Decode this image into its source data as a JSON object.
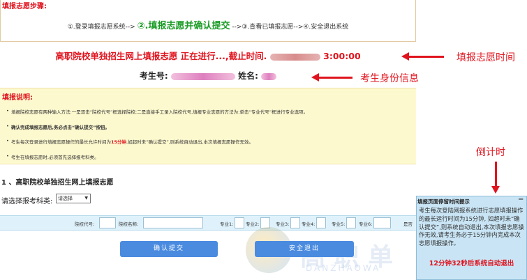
{
  "steps": {
    "heading": "填报志愿步骤:",
    "step1": "①.登录填报志愿系统-->",
    "step2": "②.填报志愿并确认提交",
    "step3": "-->③.查看已填报志愿-->④.安全退出系统"
  },
  "status": {
    "text": "高职院校单独招生网上填报志愿 正在进行...,截止时间.",
    "deadline_visible_tail": "3:00:00",
    "candidate_no_label": "考生号:",
    "name_label": "姓名:"
  },
  "annotations": {
    "deadline": "填报志愿时间",
    "identity": "考生身份信息",
    "countdown": "倒计时"
  },
  "instructions": {
    "heading": "填报说明:",
    "item1": "填报院校志愿有两种输入方法:一是双击“院校代号”框选择院校;二是直接手工录入院校代号,填报专业志愿的方法为:单击“专业代号”框进行专业选项。",
    "item2": "确认完成填报志愿后,务必点击“确认提交”按钮。",
    "item3_pre": "考生每次登录进行填报志愿操作的最长允许时间为",
    "item3_highlight": "15分钟",
    "item3_post": ",如超时未“确认提交”,则系统自动退出,本次填报志愿操作无效。",
    "item4": "考生在填报志愿时,必须首先选择报考科类。"
  },
  "section": {
    "title": "1 、高职院校单独招生网上填报志愿",
    "category_label": "请选择报考科类:",
    "category_select": "请选择"
  },
  "form": {
    "school_code": "院校代号:",
    "school_name": "院校名称:",
    "major1": "专业1:",
    "major2": "专业2:",
    "major3": "专业3:",
    "major4": "专业4:",
    "major5": "专业5:",
    "major6": "专业6:",
    "obey": "是否"
  },
  "buttons": {
    "confirm": "确认提交",
    "exit": "安全退出"
  },
  "watermark": {
    "text": "高 职 单",
    "sub": "DANZHAOWA"
  },
  "popup": {
    "title": "填报页面停留时间提示",
    "close": "−",
    "body": "考生每次登陆网报系统进行志愿填报操作的最长运行时间为15分钟, 如超时未“确认提交”,则系统自动退出,本次填报志愿操作无效,请考生务必于15分钟内完成本次志愿填报操作。",
    "countdown": "12分钟32秒后系统自动退出"
  }
}
